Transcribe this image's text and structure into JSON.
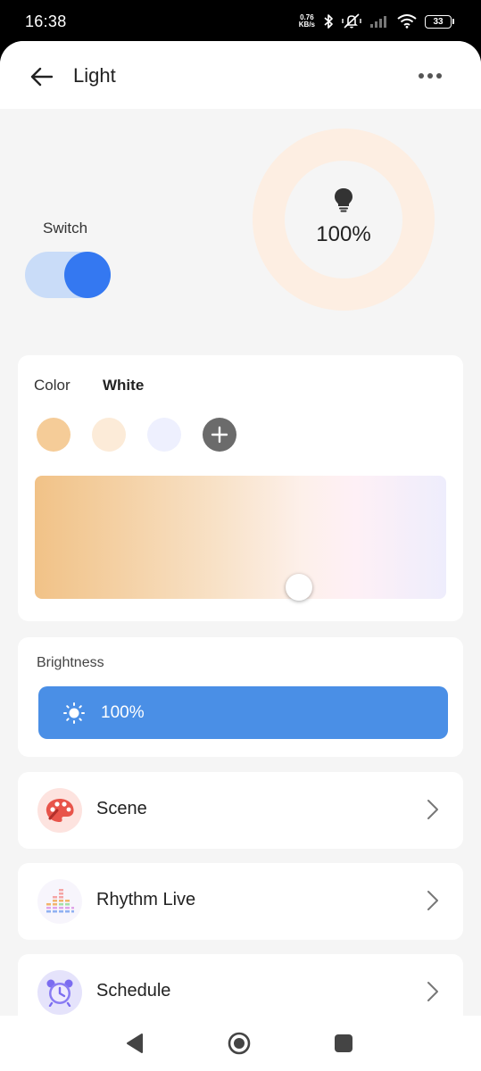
{
  "status_bar": {
    "time": "16:38",
    "net_speed_value": "0.76",
    "net_speed_unit": "KB/s",
    "battery": "33",
    "icons": [
      "bluetooth-icon",
      "mute-vibrate-icon",
      "signal-icon",
      "wifi-icon",
      "battery-icon"
    ]
  },
  "header": {
    "title": "Light",
    "back_icon": "arrow-left-icon",
    "more_icon": "more-dots-icon"
  },
  "power": {
    "switch_label": "Switch",
    "switch_on": true,
    "level_display": "100%",
    "bulb_icon": "lightbulb-icon"
  },
  "color_panel": {
    "tabs": [
      {
        "label": "Color",
        "active": false
      },
      {
        "label": "White",
        "active": true
      }
    ],
    "swatches": [
      "#f5cc98",
      "#fcebd8",
      "#eef0fe"
    ],
    "add_icon": "plus-circle-icon",
    "temperature_position": 0.64
  },
  "brightness": {
    "label": "Brightness",
    "value": "100%",
    "level": 1.0,
    "icon": "sun-icon"
  },
  "menu": [
    {
      "label": "Scene",
      "icon": "palette-icon"
    },
    {
      "label": "Rhythm Live",
      "icon": "equalizer-icon"
    },
    {
      "label": "Schedule",
      "icon": "alarm-clock-icon"
    }
  ],
  "colors": {
    "accent": "#3478f1",
    "toggle_track": "#c9dcf8",
    "brightness_bar": "#4a8fe6",
    "ring": "#fdeee2",
    "background": "#f5f5f5"
  },
  "nav": {
    "icons": [
      "nav-back-icon",
      "nav-home-icon",
      "nav-recents-icon"
    ]
  }
}
